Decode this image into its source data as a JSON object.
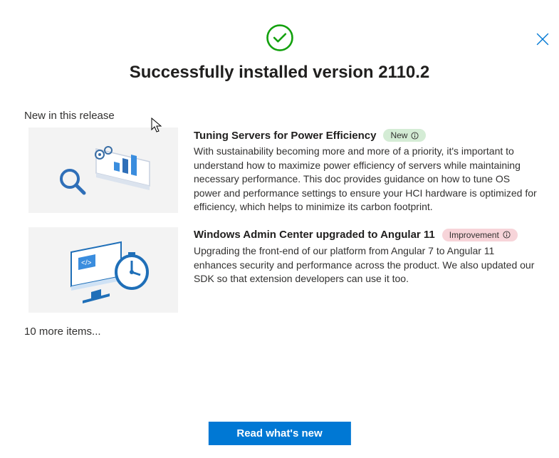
{
  "title": "Successfully installed version 2110.2",
  "section_label": "New in this release",
  "items": [
    {
      "title": "Tuning Servers for Power Efficiency",
      "badge": "New",
      "badge_type": "new",
      "description": "With sustainability becoming more and more of a priority, it's important to understand how to maximize power efficiency of servers while maintaining necessary performance. This doc provides guidance on how to tune OS power and performance settings to ensure your HCI hardware is optimized for efficiency, which helps to minimize its carbon footprint."
    },
    {
      "title": "Windows Admin Center upgraded to Angular 11",
      "badge": "Improvement",
      "badge_type": "improvement",
      "description": "Upgrading the front-end of our platform from Angular 7 to Angular 11 enhances security and performance across the product. We also updated our SDK so that extension developers can use it too."
    }
  ],
  "more_items_label": "10 more items...",
  "cta_label": "Read what's new"
}
